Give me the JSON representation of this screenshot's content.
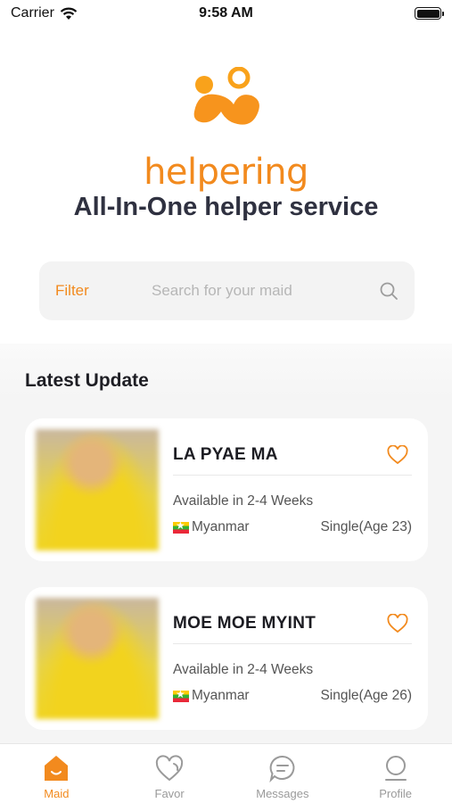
{
  "status_bar": {
    "carrier": "Carrier",
    "time": "9:58 AM"
  },
  "brand": {
    "name": "helpering",
    "tagline": "All-In-One helper service",
    "color": "#f28a1e"
  },
  "search": {
    "filter_label": "Filter",
    "placeholder": "Search for your maid"
  },
  "latest": {
    "title": "Latest Update",
    "cards": [
      {
        "name": "LA PYAE MA",
        "availability": "Available in 2-4 Weeks",
        "country": "Myanmar",
        "status": "Single(Age 23)"
      },
      {
        "name": "MOE MOE MYINT",
        "availability": "Available in 2-4 Weeks",
        "country": "Myanmar",
        "status": "Single(Age 26)"
      }
    ]
  },
  "tabs": [
    {
      "label": "Maid",
      "icon": "home-icon",
      "active": true
    },
    {
      "label": "Favor",
      "icon": "heart-icon",
      "active": false
    },
    {
      "label": "Messages",
      "icon": "chat-icon",
      "active": false
    },
    {
      "label": "Profile",
      "icon": "profile-icon",
      "active": false
    }
  ]
}
